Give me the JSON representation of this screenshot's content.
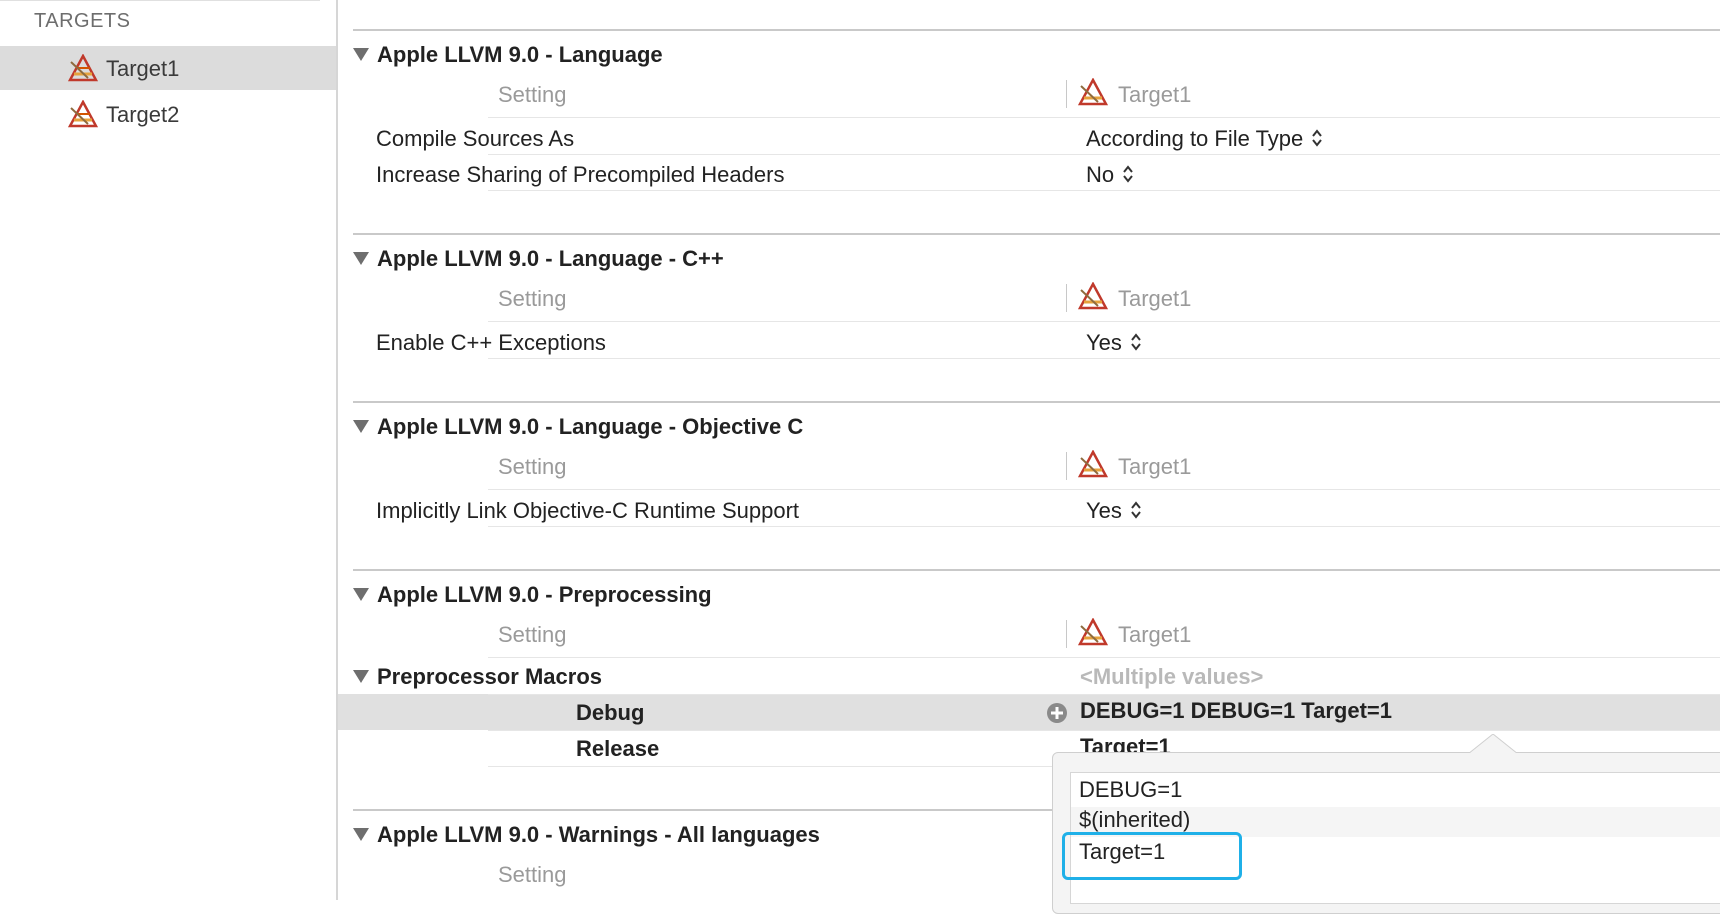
{
  "sidebar": {
    "header": "TARGETS",
    "items": [
      {
        "label": "Target1",
        "selected": true,
        "icon": "xcode-target-icon"
      },
      {
        "label": "Target2",
        "selected": false,
        "icon": "xcode-target-icon"
      }
    ]
  },
  "sections": [
    {
      "title": "Apple LLVM 9.0 - Language",
      "col_setting": "Setting",
      "col_target": "Target1",
      "rows": [
        {
          "setting": "Compile Sources As",
          "value": "According to File Type"
        },
        {
          "setting": "Increase Sharing of Precompiled Headers",
          "value": "No"
        }
      ]
    },
    {
      "title": "Apple LLVM 9.0 - Language - C++",
      "col_setting": "Setting",
      "col_target": "Target1",
      "rows": [
        {
          "setting": "Enable C++ Exceptions",
          "value": "Yes"
        }
      ]
    },
    {
      "title": "Apple LLVM 9.0 - Language - Objective C",
      "col_setting": "Setting",
      "col_target": "Target1",
      "rows": [
        {
          "setting": "Implicitly Link Objective-C Runtime Support",
          "value": "Yes"
        }
      ]
    },
    {
      "title": "Apple LLVM 9.0 - Preprocessing",
      "col_setting": "Setting",
      "col_target": "Target1",
      "macro": {
        "label": "Preprocessor Macros",
        "value": "<Multiple values>",
        "debug_label": "Debug",
        "debug_value": "DEBUG=1 DEBUG=1  Target=1",
        "release_label": "Release",
        "release_value": "Target=1"
      }
    },
    {
      "title": "Apple LLVM 9.0 - Warnings - All languages",
      "col_setting": "Setting"
    }
  ],
  "popover": {
    "items": [
      "DEBUG=1",
      "$(inherited)",
      "Target=1"
    ]
  },
  "colors": {
    "highlight": "#1fb0e8",
    "selection": "#dcdcdc"
  }
}
